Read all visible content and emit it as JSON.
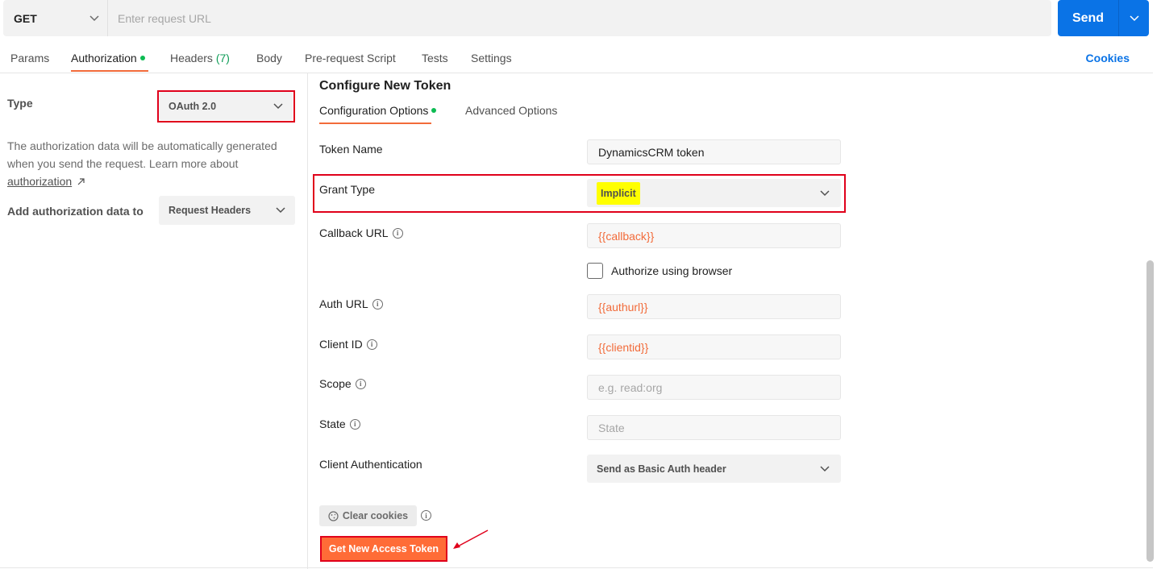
{
  "request": {
    "method": "GET",
    "url_placeholder": "Enter request URL",
    "send_label": "Send"
  },
  "tabs": [
    {
      "label": "Params"
    },
    {
      "label": "Authorization",
      "active": true,
      "has_dot": true
    },
    {
      "label": "Headers",
      "count": "(7)"
    },
    {
      "label": "Body"
    },
    {
      "label": "Pre-request Script"
    },
    {
      "label": "Tests"
    },
    {
      "label": "Settings"
    }
  ],
  "cookies_label": "Cookies",
  "auth": {
    "type_label": "Type",
    "type_value": "OAuth 2.0",
    "description": "The authorization data will be automatically generated when you send the request. Learn more about",
    "link_text": "authorization",
    "add_to_label": "Add authorization data to",
    "add_to_value": "Request Headers"
  },
  "config": {
    "title": "Configure New Token",
    "subtabs": [
      {
        "label": "Configuration Options",
        "active": true
      },
      {
        "label": "Advanced Options"
      }
    ],
    "fields": {
      "token_name": {
        "label": "Token Name",
        "value": "DynamicsCRM token"
      },
      "grant_type": {
        "label": "Grant Type",
        "value": "Implicit"
      },
      "callback_url": {
        "label": "Callback URL",
        "value": "{{callback}}"
      },
      "authorize_browser": {
        "label": "Authorize using browser",
        "checked": false
      },
      "auth_url": {
        "label": "Auth URL",
        "value": "{{authurl}}"
      },
      "client_id": {
        "label": "Client ID",
        "value": "{{clientid}}"
      },
      "scope": {
        "label": "Scope",
        "placeholder": "e.g. read:org"
      },
      "state": {
        "label": "State",
        "placeholder": "State"
      },
      "client_auth": {
        "label": "Client Authentication",
        "value": "Send as Basic Auth header"
      }
    },
    "clear_cookies_label": "Clear cookies",
    "get_token_label": "Get New Access Token"
  },
  "colors": {
    "accent": "#ff6c37",
    "primary": "#0a73e6",
    "annotation_red": "#e0001b",
    "highlight": "#ffff00"
  }
}
